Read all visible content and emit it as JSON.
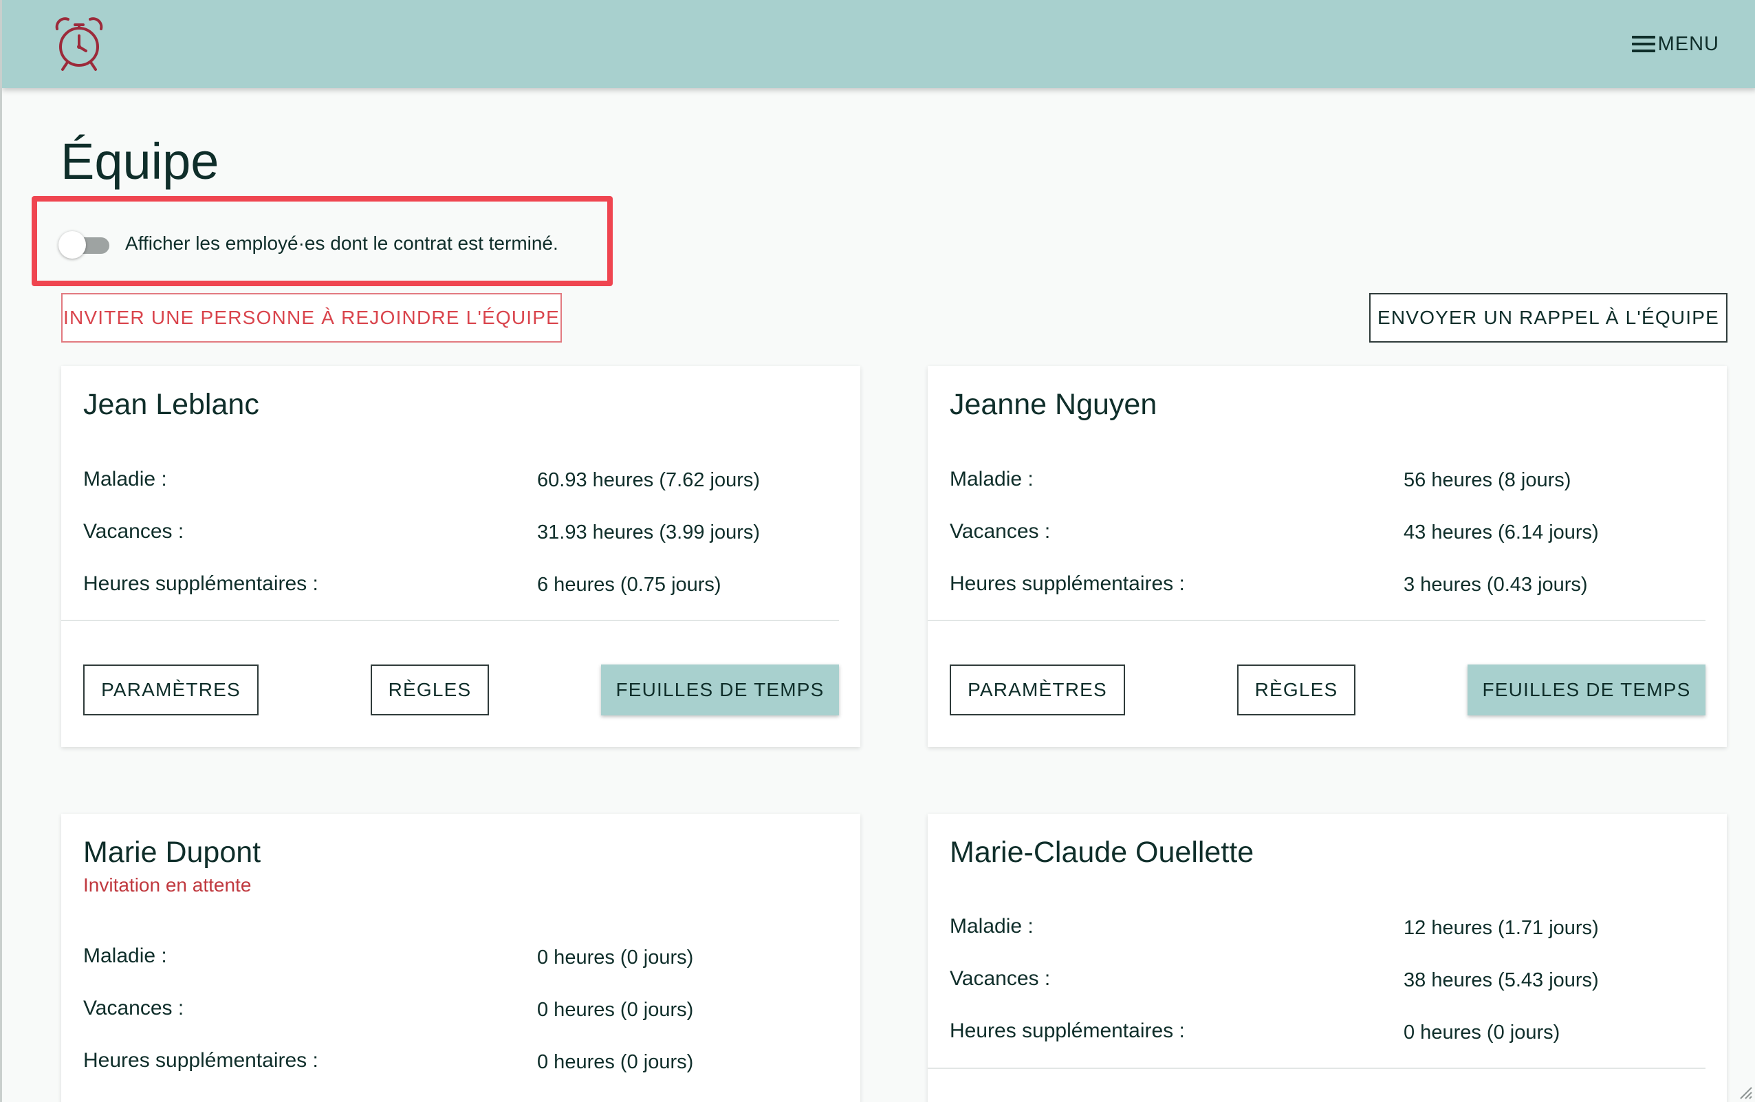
{
  "header": {
    "logo_icon": "alarm-clock-icon",
    "menu_label": "MENU",
    "accent_color": "#a8d0ce"
  },
  "page": {
    "title": "Équipe",
    "toggle_label": "Afficher les employé·es dont le contrat est terminé.",
    "toggle_on": false,
    "invite_button": "INVITER UNE PERSONNE À REJOINDRE L'ÉQUIPE",
    "reminder_button": "ENVOYER UN RAPPEL À L'ÉQUIPE"
  },
  "labels": {
    "sick": "Maladie :",
    "vacation": "Vacances :",
    "overtime": "Heures supplémentaires :",
    "settings_button": "PARAMÈTRES",
    "rules_button": "RÈGLES",
    "timesheets_button": "FEUILLES DE TEMPS"
  },
  "employees": [
    {
      "name": "Jean Leblanc",
      "status": "",
      "sick": "60.93 heures (7.62 jours)",
      "vacation": "31.93 heures (3.99 jours)",
      "overtime": "6 heures (0.75 jours)"
    },
    {
      "name": "Jeanne Nguyen",
      "status": "",
      "sick": "56 heures (8 jours)",
      "vacation": "43 heures (6.14 jours)",
      "overtime": "3 heures (0.43 jours)"
    },
    {
      "name": "Marie Dupont",
      "status": "Invitation en attente",
      "sick": "0 heures (0 jours)",
      "vacation": "0 heures (0 jours)",
      "overtime": "0 heures (0 jours)"
    },
    {
      "name": "Marie-Claude Ouellette",
      "status": "",
      "sick": "12 heures (1.71 jours)",
      "vacation": "38 heures (5.43 jours)",
      "overtime": "0 heures (0 jours)"
    }
  ]
}
